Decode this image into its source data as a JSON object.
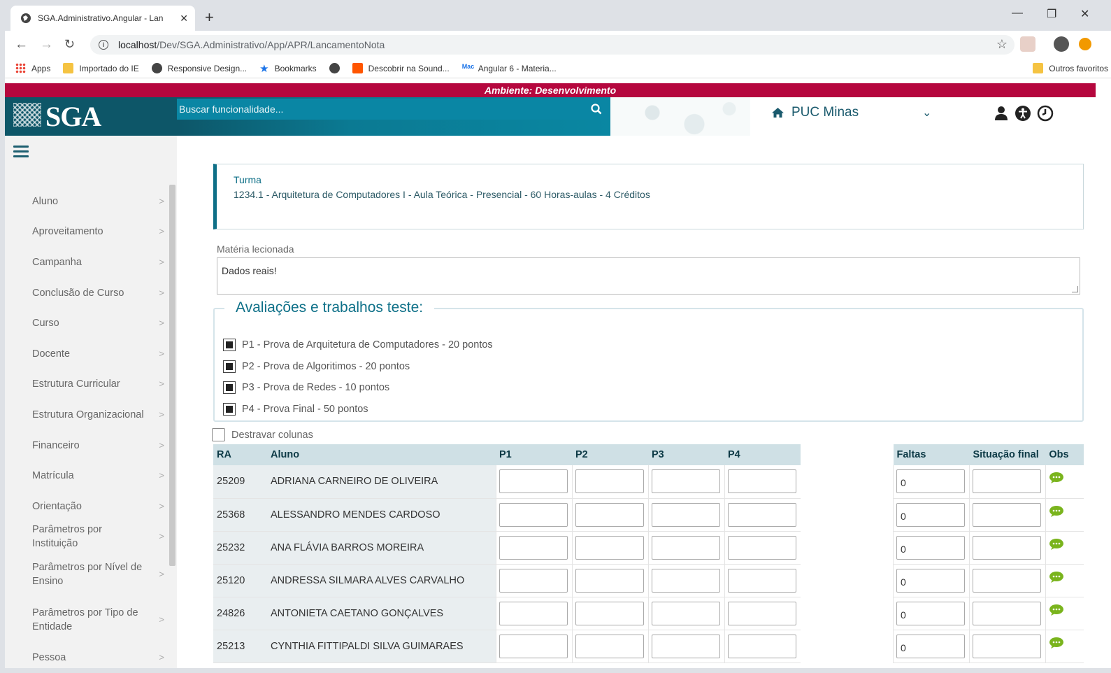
{
  "browser": {
    "tab_title": "SGA.Administrativo.Angular - Lan",
    "new_tab": "+",
    "url_host": "localhost",
    "url_path": "/Dev/SGA.Administrativo/App/APR/LancamentoNota",
    "bookmarks": [
      "Apps",
      "Importado do IE",
      "Responsive Design...",
      "Bookmarks",
      "Descobrir na Sound...",
      "Angular 6 - Materia..."
    ],
    "other_bookmarks": "Outros favoritos"
  },
  "env_banner": "Ambiente: Desenvolvimento",
  "header": {
    "logo": "SGA",
    "search_placeholder": "Buscar funcionalidade...",
    "institution": "PUC Minas"
  },
  "sidebar": {
    "items": [
      "Aluno",
      "Aproveitamento",
      "Campanha",
      "Conclusão de Curso",
      "Curso",
      "Docente",
      "Estrutura Curricular",
      "Estrutura Organizacional",
      "Financeiro",
      "Matrícula",
      "Orientação",
      "Parâmetros por Instituição",
      "Parâmetros por Nível de Ensino",
      "Parâmetros por Tipo de Entidade",
      "Pessoa"
    ]
  },
  "turma": {
    "label": "Turma",
    "text": "1234.1 - Arquitetura de Computadores I - Aula Teórica - Presencial - 60 Horas-aulas - 4 Créditos"
  },
  "materia": {
    "label": "Matéria lecionada",
    "value": "Dados reais!"
  },
  "avaliacoes": {
    "legend": "Avaliações e trabalhos teste:",
    "items": [
      "P1 - Prova de Arquitetura de Computadores - 20 pontos",
      "P2 - Prova de Algoritimos - 20 pontos",
      "P3 - Prova de Redes - 10 pontos",
      "P4 - Prova Final - 50 pontos"
    ]
  },
  "destravar_label": "Destravar colunas",
  "table": {
    "headers": [
      "RA",
      "Aluno",
      "P1",
      "P2",
      "P3",
      "P4"
    ],
    "final_headers": [
      "Faltas",
      "Situação final",
      "Obs"
    ],
    "rows": [
      {
        "ra": "25209",
        "nome": "ADRIANA CARNEIRO DE OLIVEIRA",
        "faltas": "0"
      },
      {
        "ra": "25368",
        "nome": "ALESSANDRO MENDES CARDOSO",
        "faltas": "0"
      },
      {
        "ra": "25232",
        "nome": "ANA FLÁVIA BARROS MOREIRA",
        "faltas": "0"
      },
      {
        "ra": "25120",
        "nome": "ANDRESSA SILMARA ALVES CARVALHO",
        "faltas": "0"
      },
      {
        "ra": "24826",
        "nome": "ANTONIETA CAETANO GONÇALVES",
        "faltas": "0"
      },
      {
        "ra": "25213",
        "nome": "CYNTHIA FITTIPALDI SILVA GUIMARAES",
        "faltas": "0"
      }
    ]
  },
  "colors": {
    "env_bar": "#b5073e",
    "brand_teal": "#0d5668",
    "accent": "#0e7088",
    "comment_icon": "#7ab41d"
  }
}
